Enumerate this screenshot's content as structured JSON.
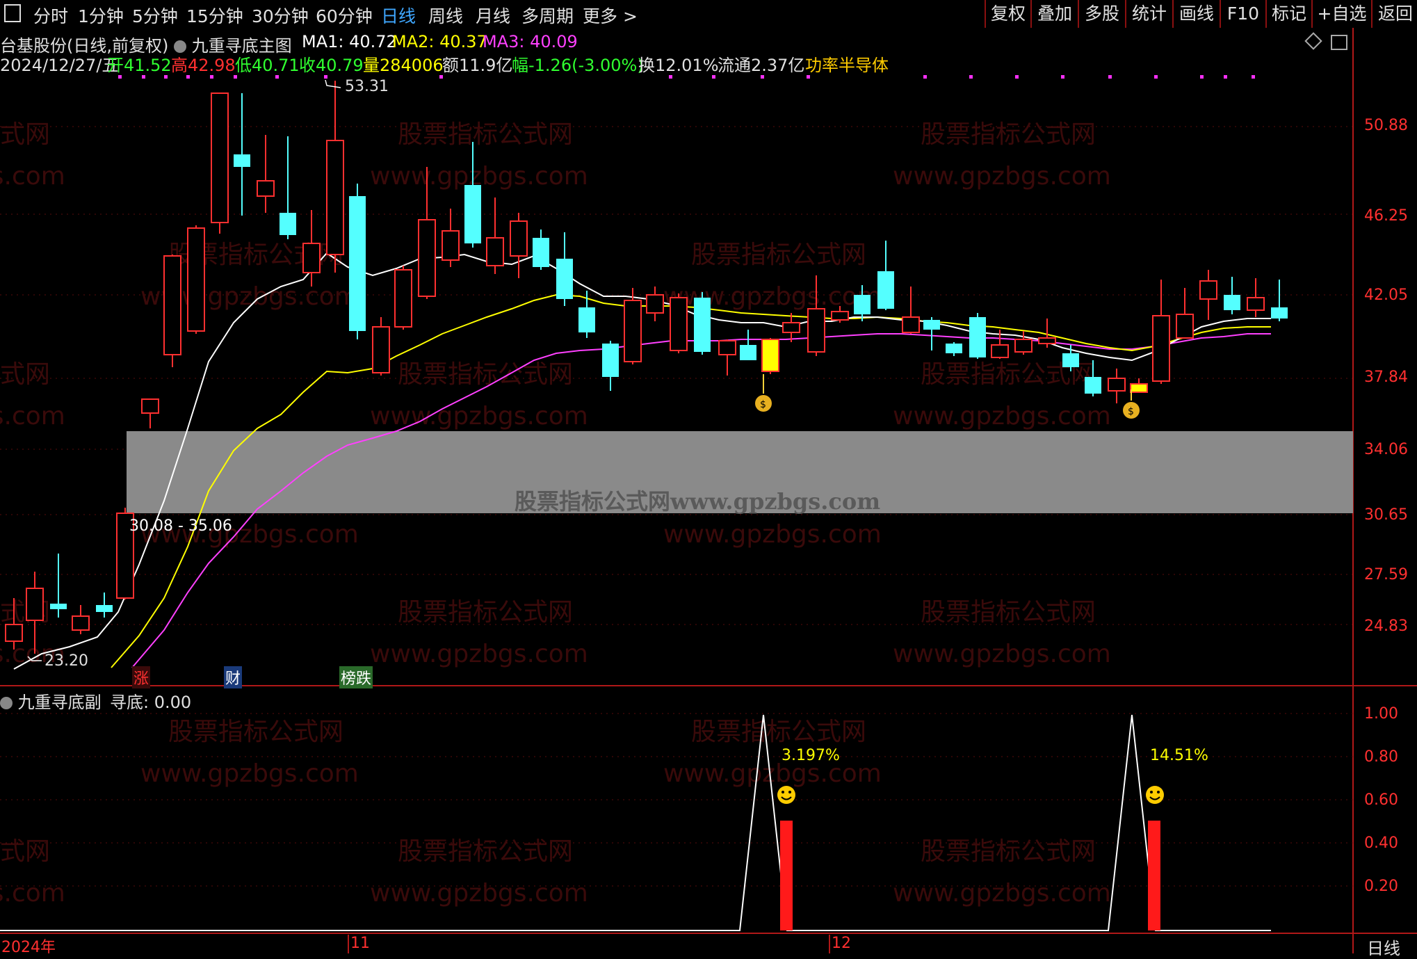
{
  "toolbar": {
    "window_icon": "window-icon",
    "periods": [
      "分时",
      "1分钟",
      "5分钟",
      "15分钟",
      "30分钟",
      "60分钟",
      "日线",
      "周线",
      "月线",
      "多周期",
      "更多"
    ],
    "active_period": "日线",
    "more_arrow": ">",
    "right_buttons": [
      "复权",
      "叠加",
      "多股",
      "统计",
      "画线",
      "F10",
      "标记",
      "+自选",
      "返回"
    ]
  },
  "main_panel": {
    "stock_title": "台基股份(日线,前复权)",
    "indicator_name": "九重寻底主图",
    "ma1": "MA1: 40.72",
    "ma2": "MA2: 40.37",
    "ma3": "MA3: 40.09",
    "date": "2024/12/27/五",
    "open": "开41.52",
    "high": "高42.98",
    "low": "低40.71",
    "close": "收40.79",
    "volume": "量284006",
    "amount": "额11.9亿",
    "change": "幅-1.26(-3.00%)",
    "turnover": "换12.01%",
    "float_cap": "流通2.37亿",
    "sector": "功率半导体",
    "high_marker": "53.31",
    "low_marker": "23.20",
    "range_label": "30.08 - 35.06",
    "band_text": "股票指标公式网www.gpzbgs.com",
    "event_tags": [
      "涨",
      "财",
      "榜跌"
    ]
  },
  "price_axis": [
    "50.88",
    "46.25",
    "42.05",
    "37.84",
    "34.06",
    "30.65",
    "27.59",
    "24.83"
  ],
  "sub_panel": {
    "title": "九重寻底副",
    "value": "寻底: 0.00",
    "signal_pct_1": "3.197%",
    "signal_pct_2": "14.51%",
    "axis": [
      "1.00",
      "0.80",
      "0.60",
      "0.40",
      "0.20"
    ]
  },
  "date_axis": [
    "2024年",
    "11",
    "12"
  ],
  "bottom_right": "日线",
  "watermark": {
    "cn": "股票指标公式网",
    "url": "www.gpzbgs.com"
  },
  "colors": {
    "up": "#ff3030",
    "down": "#54ffff",
    "ma1": "#ffffff",
    "ma2": "#ffff00",
    "ma3": "#ff40ff",
    "axis": "#c01818"
  }
}
